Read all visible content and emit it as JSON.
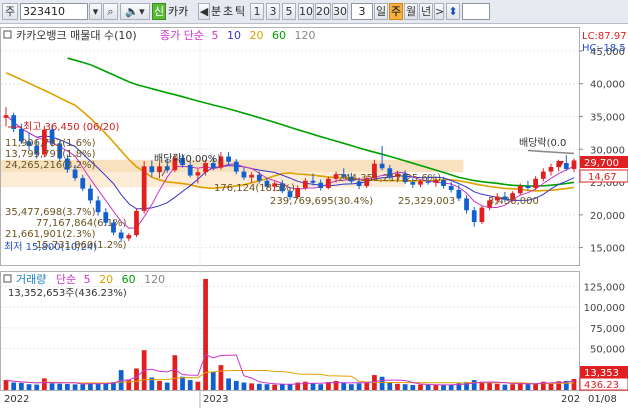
{
  "toolbar": {
    "market": "주",
    "code": "323410",
    "name": "카카",
    "sin_label": "신",
    "period_nav_left": "◀",
    "minute": "분",
    "tick": "초",
    "tick2": "틱",
    "intervals": [
      "1",
      "3",
      "5",
      "10",
      "20",
      "30"
    ],
    "count_value": "3",
    "day": "일",
    "week": "주",
    "month": "월",
    "year": "년",
    "next": ">",
    "updown": "⬍"
  },
  "price_panel": {
    "indicator_title": "카카오뱅크 매물대 수(10)",
    "ma_title": "종가 단순",
    "ma_periods": [
      "5",
      "10",
      "20",
      "60",
      "120"
    ],
    "ma_colors": [
      "#cc33cc",
      "#3333cc",
      "#e0a000",
      "#00a000",
      "#888888"
    ],
    "lc_label": "LC:87.97",
    "hc_label": "HC:-18.5",
    "y_ticks": [
      "45,000",
      "40,000",
      "35,000",
      "30,000",
      "25,000",
      "20,000",
      "15,000"
    ],
    "current_price": "29,700",
    "price_box2": "14,67",
    "high_label": "최고 36,450 (06/20)",
    "low_label": "최저 15,800(10/24)",
    "dividend1": "배당락(0.00%)",
    "dividend2": "배당락(0.0",
    "volume_profile": [
      "11,906,782(1.6%)",
      "13,799,797(1.8%)",
      "24,265,216(3.2%)",
      "35,477,698(3.7%)",
      "77,167,864(6.1%)",
      "21,661,901(2.3%)",
      "15,731,860(1.2%)",
      "176,124(18.5%)",
      "244,351,217(25.6%)",
      "239,769,695(30.4%)",
      "25,329,003",
      "3,430,000"
    ]
  },
  "volume_panel": {
    "title": "거래량",
    "ma_title": "단순",
    "ma_periods": [
      "5",
      "20",
      "60",
      "120"
    ],
    "ma_colors": [
      "#cc33cc",
      "#e0a000",
      "#00a000",
      "#888888"
    ],
    "last_volume": "13,352,653주(436.23%)",
    "y_ticks": [
      "125,000",
      "100,000",
      "75,000",
      "50,000"
    ],
    "value_box1": "13,353",
    "value_box2": "436.23"
  },
  "x_axis": {
    "labels": [
      "2022",
      "2023",
      "202",
      "01/08"
    ]
  },
  "chart_data": {
    "type": "candlestick",
    "title": "카카오뱅크",
    "ylim": [
      12500,
      48500
    ],
    "volume_ylim": [
      0,
      140000
    ],
    "price_ticks": [
      45000,
      40000,
      35000,
      30000,
      25000,
      20000,
      15000
    ],
    "volume_ticks": [
      125000,
      100000,
      75000,
      50000
    ],
    "candles": [
      {
        "o": 34800,
        "h": 36450,
        "l": 33500,
        "c": 35200,
        "v": 12000
      },
      {
        "o": 35200,
        "h": 35600,
        "l": 32600,
        "c": 33100,
        "v": 9000
      },
      {
        "o": 33100,
        "h": 33900,
        "l": 30800,
        "c": 31200,
        "v": 8500
      },
      {
        "o": 31200,
        "h": 32500,
        "l": 29900,
        "c": 30500,
        "v": 7000
      },
      {
        "o": 30500,
        "h": 31400,
        "l": 28600,
        "c": 29200,
        "v": 6500
      },
      {
        "o": 29200,
        "h": 33600,
        "l": 28800,
        "c": 33000,
        "v": 14000
      },
      {
        "o": 33000,
        "h": 33800,
        "l": 30400,
        "c": 30900,
        "v": 8000
      },
      {
        "o": 30900,
        "h": 31300,
        "l": 28200,
        "c": 28600,
        "v": 7500
      },
      {
        "o": 28600,
        "h": 29200,
        "l": 26400,
        "c": 26900,
        "v": 7200
      },
      {
        "o": 26900,
        "h": 27600,
        "l": 25200,
        "c": 25600,
        "v": 6800
      },
      {
        "o": 25600,
        "h": 26100,
        "l": 23600,
        "c": 24000,
        "v": 7000
      },
      {
        "o": 24000,
        "h": 24600,
        "l": 21700,
        "c": 22200,
        "v": 9000
      },
      {
        "o": 22200,
        "h": 22900,
        "l": 19900,
        "c": 20400,
        "v": 8000
      },
      {
        "o": 20400,
        "h": 21000,
        "l": 18300,
        "c": 18800,
        "v": 7600
      },
      {
        "o": 18800,
        "h": 19300,
        "l": 16900,
        "c": 17300,
        "v": 9500
      },
      {
        "o": 17300,
        "h": 17800,
        "l": 15800,
        "c": 16400,
        "v": 24000
      },
      {
        "o": 16400,
        "h": 17200,
        "l": 16000,
        "c": 16900,
        "v": 12000
      },
      {
        "o": 16900,
        "h": 21000,
        "l": 16600,
        "c": 20600,
        "v": 26000
      },
      {
        "o": 20600,
        "h": 28200,
        "l": 20200,
        "c": 27400,
        "v": 48000
      },
      {
        "o": 27400,
        "h": 28300,
        "l": 25800,
        "c": 26500,
        "v": 15000
      },
      {
        "o": 26500,
        "h": 28000,
        "l": 25600,
        "c": 27400,
        "v": 11000
      },
      {
        "o": 27400,
        "h": 28600,
        "l": 26400,
        "c": 26800,
        "v": 9000
      },
      {
        "o": 26800,
        "h": 29200,
        "l": 26500,
        "c": 28700,
        "v": 42000
      },
      {
        "o": 28700,
        "h": 29300,
        "l": 27200,
        "c": 27600,
        "v": 16000
      },
      {
        "o": 27600,
        "h": 28100,
        "l": 25700,
        "c": 26000,
        "v": 12000
      },
      {
        "o": 26000,
        "h": 27000,
        "l": 24800,
        "c": 26500,
        "v": 10000
      },
      {
        "o": 26500,
        "h": 28400,
        "l": 26000,
        "c": 27900,
        "v": 134000
      },
      {
        "o": 27900,
        "h": 28800,
        "l": 26800,
        "c": 27200,
        "v": 22000
      },
      {
        "o": 27200,
        "h": 29600,
        "l": 26900,
        "c": 28900,
        "v": 30000
      },
      {
        "o": 28900,
        "h": 29600,
        "l": 27600,
        "c": 28100,
        "v": 14000
      },
      {
        "o": 28100,
        "h": 28500,
        "l": 26200,
        "c": 26600,
        "v": 11000
      },
      {
        "o": 26600,
        "h": 27200,
        "l": 25300,
        "c": 25700,
        "v": 9000
      },
      {
        "o": 25700,
        "h": 26500,
        "l": 24900,
        "c": 26100,
        "v": 8000
      },
      {
        "o": 26100,
        "h": 26600,
        "l": 24800,
        "c": 25200,
        "v": 7500
      },
      {
        "o": 25200,
        "h": 25700,
        "l": 23900,
        "c": 24300,
        "v": 7000
      },
      {
        "o": 24300,
        "h": 25100,
        "l": 23600,
        "c": 24800,
        "v": 6500
      },
      {
        "o": 24800,
        "h": 25300,
        "l": 23300,
        "c": 23600,
        "v": 6800
      },
      {
        "o": 23600,
        "h": 24200,
        "l": 22300,
        "c": 22700,
        "v": 7200
      },
      {
        "o": 22700,
        "h": 24500,
        "l": 22400,
        "c": 24100,
        "v": 9000
      },
      {
        "o": 24100,
        "h": 25600,
        "l": 23800,
        "c": 25200,
        "v": 10000
      },
      {
        "o": 25200,
        "h": 26300,
        "l": 24500,
        "c": 24900,
        "v": 8000
      },
      {
        "o": 24900,
        "h": 25400,
        "l": 23700,
        "c": 24100,
        "v": 7000
      },
      {
        "o": 24100,
        "h": 25800,
        "l": 23900,
        "c": 25500,
        "v": 9500
      },
      {
        "o": 25500,
        "h": 26600,
        "l": 24900,
        "c": 26200,
        "v": 11000
      },
      {
        "o": 26200,
        "h": 27100,
        "l": 25500,
        "c": 25800,
        "v": 8500
      },
      {
        "o": 25800,
        "h": 26400,
        "l": 24800,
        "c": 25100,
        "v": 7000
      },
      {
        "o": 25100,
        "h": 25700,
        "l": 23900,
        "c": 24400,
        "v": 8000
      },
      {
        "o": 24400,
        "h": 25900,
        "l": 24100,
        "c": 25600,
        "v": 9000
      },
      {
        "o": 25600,
        "h": 28400,
        "l": 25300,
        "c": 27800,
        "v": 18000
      },
      {
        "o": 27800,
        "h": 30500,
        "l": 26800,
        "c": 27100,
        "v": 16000
      },
      {
        "o": 27100,
        "h": 27600,
        "l": 25400,
        "c": 25800,
        "v": 9000
      },
      {
        "o": 25800,
        "h": 26700,
        "l": 25000,
        "c": 26300,
        "v": 7500
      },
      {
        "o": 26300,
        "h": 26800,
        "l": 24700,
        "c": 25000,
        "v": 7000
      },
      {
        "o": 25000,
        "h": 25600,
        "l": 24100,
        "c": 24600,
        "v": 6000
      },
      {
        "o": 24600,
        "h": 25400,
        "l": 24200,
        "c": 25100,
        "v": 6500
      },
      {
        "o": 25100,
        "h": 26000,
        "l": 24600,
        "c": 24900,
        "v": 6000
      },
      {
        "o": 24900,
        "h": 25700,
        "l": 24300,
        "c": 25300,
        "v": 6500
      },
      {
        "o": 25300,
        "h": 25800,
        "l": 24000,
        "c": 24400,
        "v": 6000
      },
      {
        "o": 24400,
        "h": 25000,
        "l": 23400,
        "c": 23800,
        "v": 6500
      },
      {
        "o": 23800,
        "h": 24600,
        "l": 22100,
        "c": 22500,
        "v": 8000
      },
      {
        "o": 22500,
        "h": 23000,
        "l": 20200,
        "c": 20700,
        "v": 9500
      },
      {
        "o": 20700,
        "h": 21200,
        "l": 18200,
        "c": 18900,
        "v": 12000
      },
      {
        "o": 18900,
        "h": 21400,
        "l": 18600,
        "c": 21100,
        "v": 10000
      },
      {
        "o": 21100,
        "h": 22600,
        "l": 20700,
        "c": 22200,
        "v": 8500
      },
      {
        "o": 22200,
        "h": 23300,
        "l": 21600,
        "c": 22800,
        "v": 7500
      },
      {
        "o": 22800,
        "h": 23500,
        "l": 21900,
        "c": 22300,
        "v": 6500
      },
      {
        "o": 22300,
        "h": 23600,
        "l": 22000,
        "c": 23300,
        "v": 7000
      },
      {
        "o": 23300,
        "h": 24800,
        "l": 23000,
        "c": 24400,
        "v": 9000
      },
      {
        "o": 24400,
        "h": 25200,
        "l": 23700,
        "c": 24100,
        "v": 7000
      },
      {
        "o": 24100,
        "h": 25900,
        "l": 23800,
        "c": 25500,
        "v": 8000
      },
      {
        "o": 25500,
        "h": 27100,
        "l": 25100,
        "c": 26600,
        "v": 10000
      },
      {
        "o": 26600,
        "h": 27800,
        "l": 26000,
        "c": 27300,
        "v": 9000
      },
      {
        "o": 27300,
        "h": 28400,
        "l": 26600,
        "c": 27900,
        "v": 10500
      },
      {
        "o": 27900,
        "h": 29100,
        "l": 26700,
        "c": 27000,
        "v": 11000
      },
      {
        "o": 27000,
        "h": 28600,
        "l": 26500,
        "c": 28300,
        "v": 13350
      }
    ],
    "ma": {
      "5": {
        "color": "#cc33cc",
        "start": 0
      },
      "10": {
        "color": "#3333cc",
        "start": 0
      },
      "20": {
        "color": "#e0a000",
        "start": 0
      },
      "60": {
        "color": "#00a000",
        "start": 8
      },
      "120": {
        "color": "#888888",
        "start": 68
      }
    },
    "ma20_pre": [
      44000,
      42000,
      40000,
      38500,
      37000
    ],
    "ma60_pre": [
      51000,
      50000,
      49000,
      48200,
      47500,
      46800,
      46000,
      45200
    ],
    "ma120_pre": [
      38500,
      38000,
      37500,
      37000,
      36500,
      36000,
      35500,
      35000
    ]
  }
}
